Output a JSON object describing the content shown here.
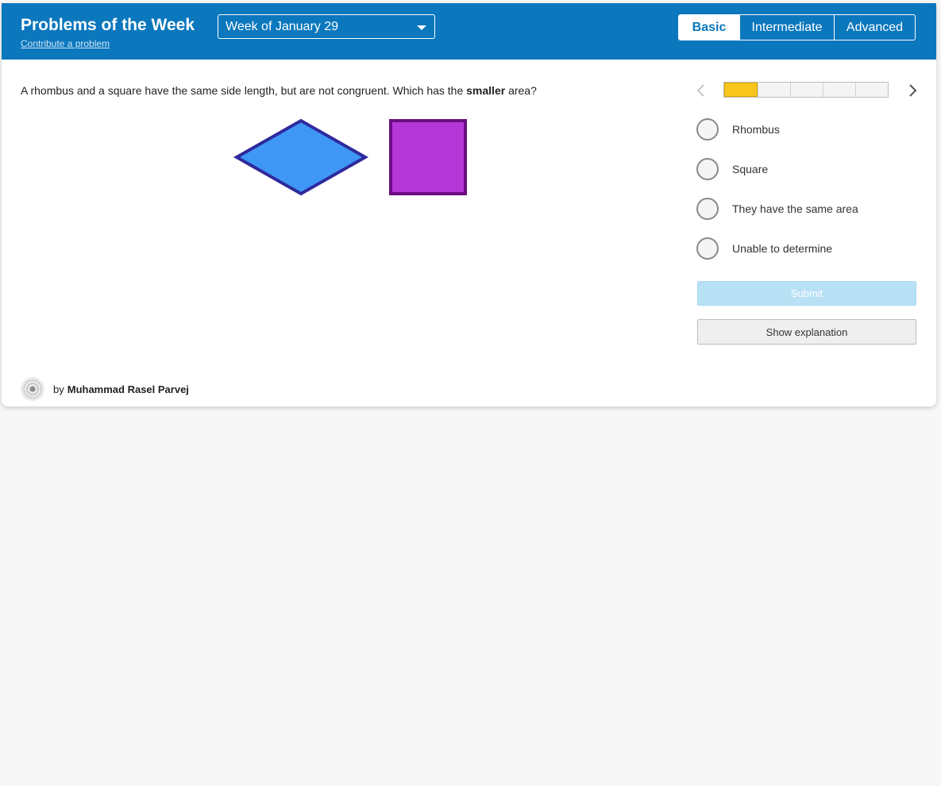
{
  "header": {
    "title": "Problems of the Week",
    "contribute_link": "Contribute a problem",
    "week_select": {
      "selected": "Week of January 29"
    },
    "level_tabs": [
      {
        "label": "Basic",
        "active": true
      },
      {
        "label": "Intermediate",
        "active": false
      },
      {
        "label": "Advanced",
        "active": false
      }
    ]
  },
  "problem": {
    "question_before": "A rhombus and a square have the same side length, but are not congruent. Which has the ",
    "question_emphasis": "smaller",
    "question_after": " area?",
    "shapes": [
      {
        "name": "rhombus",
        "fill": "#3f97f5",
        "stroke": "#2e2a9c"
      },
      {
        "name": "square",
        "fill": "#b537d8",
        "stroke": "#6a0d82"
      }
    ]
  },
  "navigation": {
    "prev_icon": "chevron-left-icon",
    "next_icon": "chevron-right-icon",
    "progress": {
      "total": 5,
      "current": 1,
      "current_color": "#f7c51c"
    }
  },
  "answers": {
    "options": [
      "Rhombus",
      "Square",
      "They have the same area",
      "Unable to determine"
    ],
    "submit_label": "Submit",
    "explanation_label": "Show explanation"
  },
  "author": {
    "prefix": "by",
    "name": "Muhammad Rasel Parvej"
  },
  "colors": {
    "header_bg": "#0b77bd",
    "submit_disabled_bg": "#b8e1f6"
  }
}
